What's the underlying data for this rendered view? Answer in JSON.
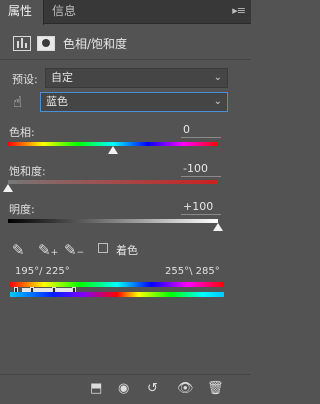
{
  "tabs": [
    {
      "label": "属性"
    },
    {
      "label": "信息"
    }
  ],
  "panel_menu_icon": "panel-menu-icon",
  "header": {
    "title": "色相/饱和度"
  },
  "preset": {
    "label": "预设:",
    "value": "自定"
  },
  "channel": {
    "value": "蓝色"
  },
  "hue": {
    "label": "色相:",
    "value": "0",
    "level": 0.5
  },
  "saturation": {
    "label": "饱和度:",
    "value": "-100",
    "level": 0.0
  },
  "lightness": {
    "label": "明度:",
    "value": "+100",
    "level": 1.0
  },
  "colorize": {
    "label": "着色",
    "checked": false
  },
  "range": {
    "left": "195°/ 225°",
    "right": "255°\\ 285°"
  },
  "footer_icons": [
    "clip-to-layer-icon",
    "view-previous-icon",
    "reset-icon",
    "visibility-icon",
    "delete-icon"
  ]
}
